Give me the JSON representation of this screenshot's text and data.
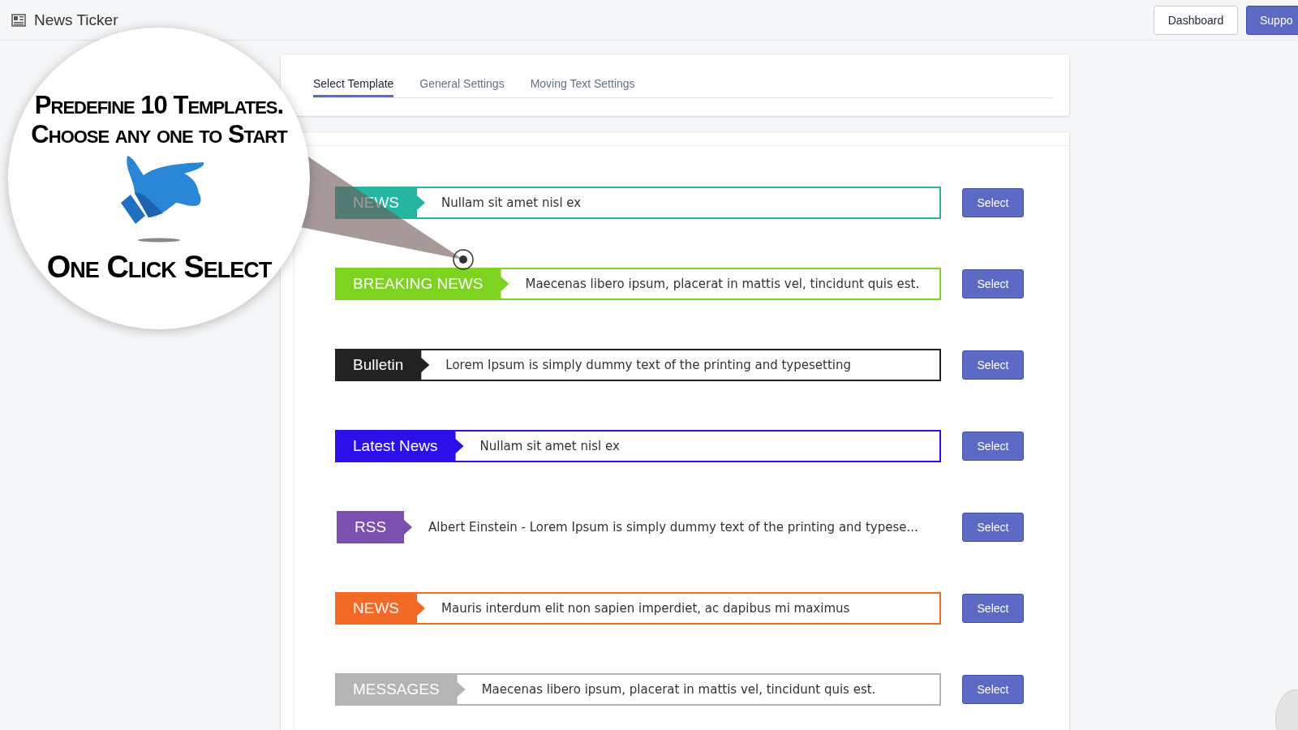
{
  "header": {
    "title": "News Ticker",
    "buttons": [
      {
        "label": "Dashboard",
        "kind": "plain"
      },
      {
        "label": "Suppo",
        "kind": "primary"
      }
    ]
  },
  "tabs": [
    {
      "label": "Select Template",
      "selected": true
    },
    {
      "label": "General Settings",
      "selected": false
    },
    {
      "label": "Moving Text Settings",
      "selected": false
    }
  ],
  "templates": [
    {
      "label": "NEWS",
      "text": "Nullam sit amet nisl ex",
      "color": "#26b5a0",
      "bordered": true,
      "button": "Select"
    },
    {
      "label": "BREAKING NEWS",
      "text": "Maecenas libero ipsum, placerat in mattis vel, tincidunt quis est.",
      "color": "#7ed321",
      "bordered": true,
      "button": "Select"
    },
    {
      "label": "Bulletin",
      "text": "Lorem Ipsum is simply dummy text of the printing and typesetting",
      "color": "#222222",
      "bordered": true,
      "button": "Select"
    },
    {
      "label": "Latest News",
      "text": "Nullam sit amet nisl ex",
      "color": "#2b10ea",
      "bordered": true,
      "button": "Select"
    },
    {
      "label": "RSS",
      "text": "Albert Einstein - Lorem Ipsum is simply dummy text of the printing and typese...",
      "color": "#7b4fae",
      "bordered": false,
      "button": "Select"
    },
    {
      "label": "NEWS",
      "text": "Mauris interdum elit non sapien imperdiet, ac dapibus mi maximus",
      "color": "#f26a25",
      "bordered": true,
      "button": "Select"
    },
    {
      "label": "MESSAGES",
      "text": "Maecenas libero ipsum, placerat in mattis vel, tincidunt quis est.",
      "color": "#b4b4b4",
      "bordered": true,
      "button": "Select"
    }
  ],
  "promo": {
    "lines": [
      "Predefine 10 Templates.",
      "Choose any one to Start"
    ],
    "footer": "One Click Select"
  }
}
